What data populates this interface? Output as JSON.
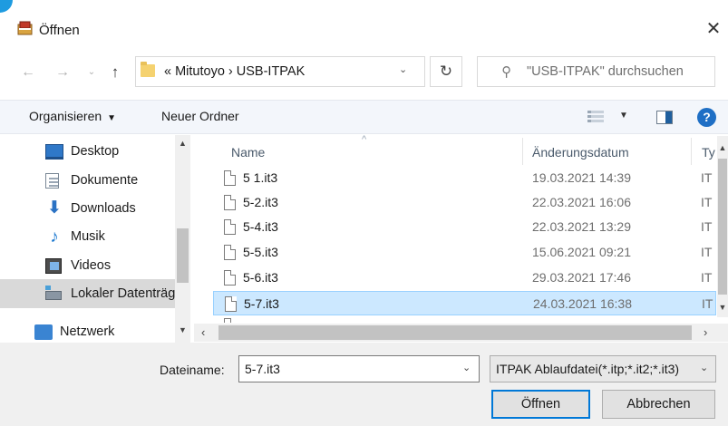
{
  "window": {
    "title": "Öffnen",
    "close_glyph": "✕"
  },
  "nav": {
    "back_glyph": "←",
    "forward_glyph": "→",
    "recent_glyph": "⌄",
    "up_glyph": "↑",
    "address": "«  Mitutoyo  ›  USB-ITPAK",
    "address_dropdown_glyph": "⌄",
    "refresh_glyph": "↻",
    "search_placeholder": "\"USB-ITPAK\" durchsuchen",
    "search_glyph": "⚲"
  },
  "toolbar": {
    "organize_label": "Organisieren",
    "organize_caret": "▼",
    "new_folder_label": "Neuer Ordner",
    "view_caret": "▼",
    "help_glyph": "?"
  },
  "sidebar": {
    "items": [
      {
        "label": "Desktop",
        "icon": "desktop-icon"
      },
      {
        "label": "Dokumente",
        "icon": "documents-icon"
      },
      {
        "label": "Downloads",
        "icon": "downloads-icon"
      },
      {
        "label": "Musik",
        "icon": "music-icon"
      },
      {
        "label": "Videos",
        "icon": "videos-icon"
      },
      {
        "label": "Lokaler Datenträger",
        "icon": "drive-icon",
        "selected": true
      },
      {
        "label": "Netzwerk",
        "icon": "network-icon"
      }
    ]
  },
  "columns": {
    "name": "Name",
    "date": "Änderungsdatum",
    "type": "Ty"
  },
  "files": [
    {
      "name": "5 1.it3",
      "date": "19.03.2021 14:39",
      "type": "IT"
    },
    {
      "name": "5-2.it3",
      "date": "22.03.2021 16:06",
      "type": "IT"
    },
    {
      "name": "5-4.it3",
      "date": "22.03.2021 13:29",
      "type": "IT"
    },
    {
      "name": "5-5.it3",
      "date": "15.06.2021 09:21",
      "type": "IT"
    },
    {
      "name": "5-6.it3",
      "date": "29.03.2021 17:46",
      "type": "IT"
    },
    {
      "name": "5-7.it3",
      "date": "24.03.2021 16:38",
      "type": "IT"
    }
  ],
  "selected_file_index": 5,
  "filename": {
    "label": "Dateiname:",
    "value": "5-7.it3"
  },
  "filetype": {
    "value": "ITPAK Ablaufdatei(*.itp;*.it2;*.it3)"
  },
  "buttons": {
    "open": "Öffnen",
    "cancel": "Abbrechen"
  },
  "colors": {
    "accent": "#0078d7",
    "selection": "#cce8ff",
    "toolbar_bg": "#f3f6fb"
  }
}
